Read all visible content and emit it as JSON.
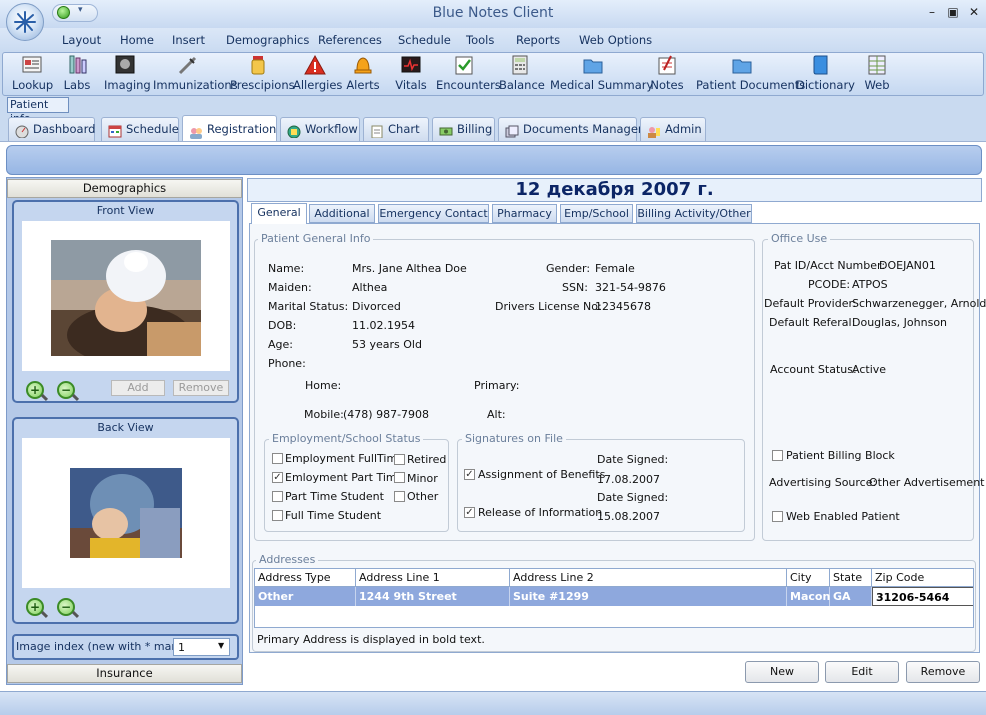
{
  "window": {
    "title": "Blue Notes Client"
  },
  "menu": [
    "Layout",
    "Home",
    "Insert",
    "Demographics",
    "References",
    "Schedule",
    "Tools",
    "Reports",
    "Web Options"
  ],
  "ribbon": [
    "Lookup",
    "Labs",
    "Imaging",
    "Immunizations",
    "Prescipions",
    "Allergies",
    "Alerts",
    "Vitals",
    "Encounters",
    "Balance",
    "Medical Summary",
    "Notes",
    "Patient Documents",
    "Dictionary",
    "Web"
  ],
  "patient_info_tab": "Patient info",
  "main_tabs": [
    "Dashboard",
    "Schedule",
    "Registration",
    "Workflow",
    "Chart",
    "Billing",
    "Documents Manager",
    "Admin"
  ],
  "left": {
    "demographics": "Demographics",
    "front_view": "Front View",
    "back_view": "Back View",
    "add": "Add",
    "remove": "Remove",
    "image_index_label": "Image index (new with * mark):",
    "image_index_value": "1",
    "insurance": "Insurance"
  },
  "date_banner": "12 декабря 2007 г.",
  "sub_tabs": [
    "General",
    "Additional",
    "Emergency Contact",
    "Pharmacy",
    "Emp/School",
    "Billing Activity/Other"
  ],
  "general": {
    "legend": "Patient General Info",
    "name_label": "Name:",
    "name": "Mrs. Jane Althea Doe",
    "maiden_label": "Maiden:",
    "maiden": "Althea",
    "marital_label": "Marital Status:",
    "marital": "Divorced",
    "dob_label": "DOB:",
    "dob": "11.02.1954",
    "age_label": "Age:",
    "age": "53 years Old",
    "phone_label": "Phone:",
    "home_label": "Home:",
    "mobile_label": "Mobile:",
    "mobile": "(478)  987-7908",
    "gender_label": "Gender:",
    "gender": "Female",
    "ssn_label": "SSN:",
    "ssn": "321-54-9876",
    "dl_label": "Drivers License No:",
    "dl": "12345678",
    "primary_label": "Primary:",
    "alt_label": "Alt:"
  },
  "employment": {
    "legend": "Employment/School Status",
    "items": [
      {
        "label": "Employment FullTime",
        "checked": false
      },
      {
        "label": "Emloyment Part Time",
        "checked": true
      },
      {
        "label": "Part Time Student",
        "checked": false
      },
      {
        "label": "Full Time Student",
        "checked": false
      },
      {
        "label": "Retired",
        "checked": false
      },
      {
        "label": "Minor",
        "checked": false
      },
      {
        "label": "Other",
        "checked": false
      }
    ]
  },
  "signatures": {
    "legend": "Signatures on File",
    "assignment": "Assignment of Benefits",
    "release": "Release of Information",
    "date_signed_label": "Date Signed:",
    "assignment_date": "17.08.2007",
    "release_date": "15.08.2007"
  },
  "office": {
    "legend": "Office Use",
    "pat_id_label": "Pat ID/Acct Number:",
    "pat_id": "DOEJAN01",
    "pcode_label": "PCODE:",
    "pcode": "ATPOS",
    "provider_label": "Default Provider:",
    "provider": "Schwarzenegger, Arnold",
    "referal_label": "Default Referal:",
    "referal": "Douglas, Johnson",
    "status_label": "Account Status:",
    "status": "Active",
    "billing_block": "Patient Billing Block",
    "adv_label": "Advertising Source:",
    "adv": "Other Advertisement",
    "web_enabled": "Web Enabled Patient"
  },
  "addresses": {
    "legend": "Addresses",
    "headers": [
      "Address Type",
      "Address Line 1",
      "Address Line 2",
      "City",
      "State",
      "Zip Code"
    ],
    "row": [
      "Other",
      "1244 9th Street",
      "Suite #1299",
      "Macon",
      "GA",
      "31206-5464"
    ],
    "note": "Primary Address is displayed in bold text."
  },
  "buttons": {
    "new": "New",
    "edit": "Edit",
    "remove": "Remove"
  },
  "colors": {
    "accent": "#0c2566",
    "selected_row": "#8ea8dd",
    "frame": "#4c70ac"
  }
}
